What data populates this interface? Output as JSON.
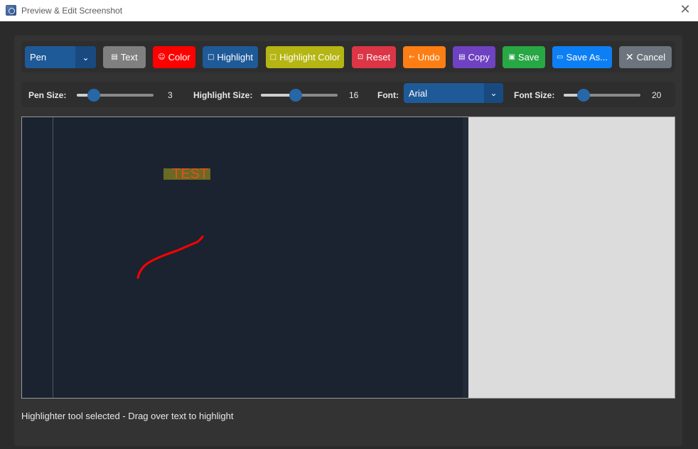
{
  "window": {
    "title": "Preview & Edit Screenshot"
  },
  "toolbar": {
    "mode": {
      "value": "Pen"
    },
    "buttons": {
      "text": {
        "label": "Text",
        "color": "#808080"
      },
      "color": {
        "label": "Color",
        "color": "#ff0000"
      },
      "highlight": {
        "label": "Highlight",
        "color": "#1f5a98"
      },
      "highlight_color": {
        "label": "Highlight Color",
        "color": "#b5b513"
      },
      "reset": {
        "label": "Reset",
        "color": "#dc3545"
      },
      "undo": {
        "label": "Undo",
        "color": "#fd7e14"
      },
      "copy": {
        "label": "Copy",
        "color": "#6f42c1"
      },
      "save": {
        "label": "Save",
        "color": "#28a745"
      },
      "save_as": {
        "label": "Save As...",
        "color": "#0d7ff5"
      },
      "cancel": {
        "label": "Cancel",
        "color": "#6c757d"
      }
    }
  },
  "settings": {
    "pen_size": {
      "label": "Pen Size:",
      "value": "3",
      "fraction": 0.22
    },
    "highlight_size": {
      "label": "Highlight Size:",
      "value": "16",
      "fraction": 0.45
    },
    "font": {
      "label": "Font:",
      "value": "Arial"
    },
    "font_size": {
      "label": "Font Size:",
      "value": "20",
      "fraction": 0.26
    }
  },
  "canvas": {
    "annotation_text": "TEST",
    "pen_color": "#ff0000",
    "highlight_color": "#6a6a24"
  },
  "status": {
    "message": "Highlighter tool selected - Drag over text to highlight"
  }
}
